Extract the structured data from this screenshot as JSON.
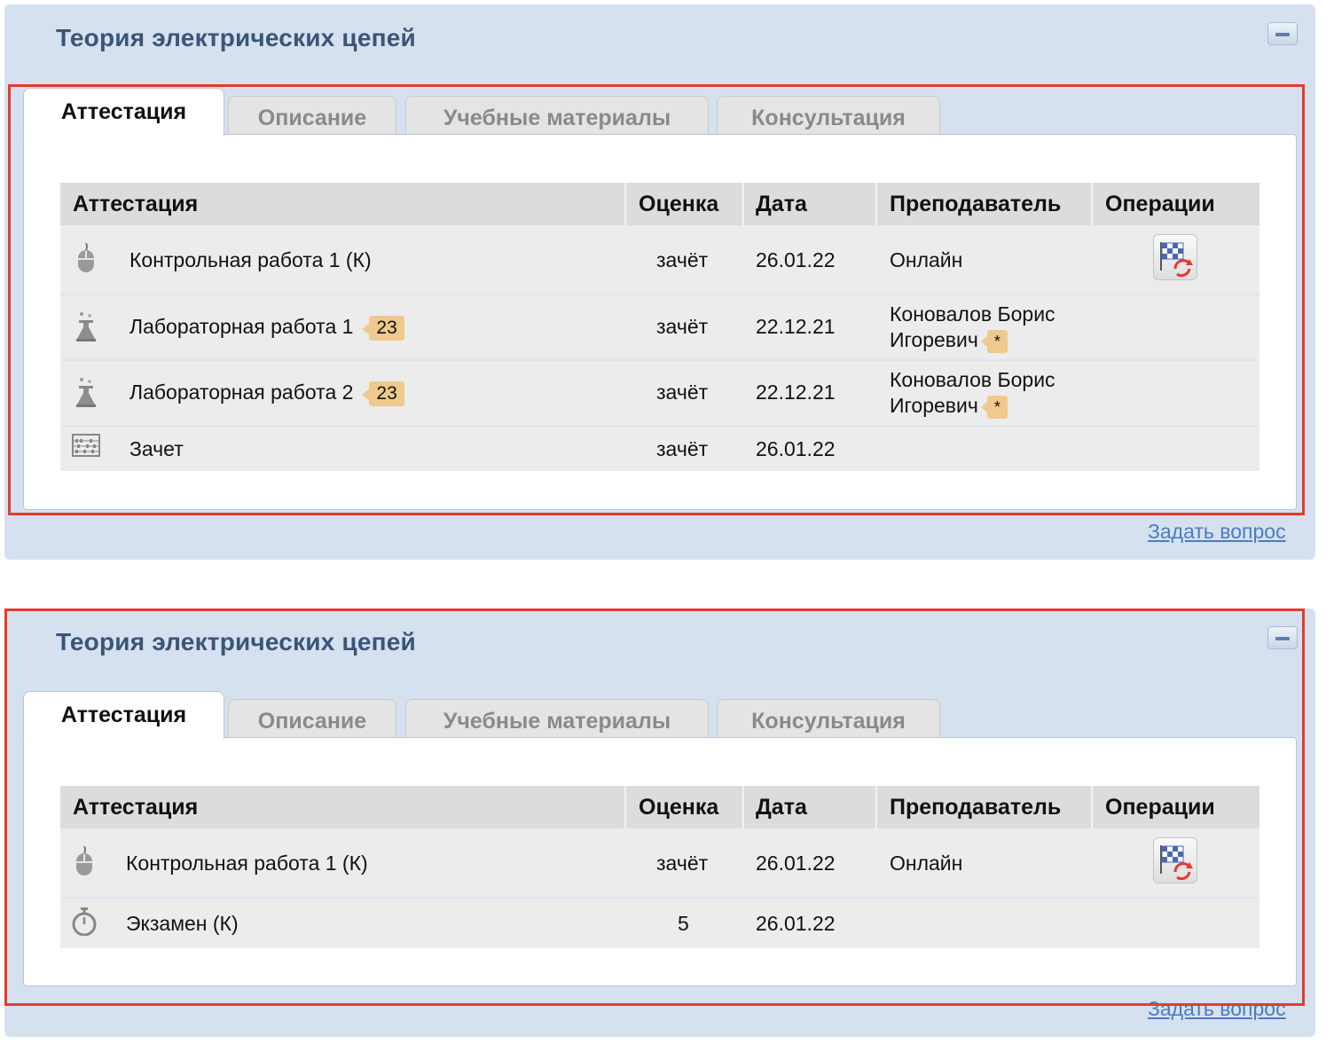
{
  "panels": [
    {
      "title": "Теория электрических цепей",
      "tabs": [
        "Аттестация",
        "Описание",
        "Учебные материалы",
        "Консультация"
      ],
      "headers": [
        "Аттестация",
        "Оценка",
        "Дата",
        "Преподаватель",
        "Операции"
      ],
      "rows": [
        {
          "icon": "mouse-icon",
          "name": "Контрольная работа 1 (К)",
          "badge": "",
          "grade": "зачёт",
          "date": "26.01.22",
          "teacher1": "Онлайн",
          "teacher2": "",
          "star": "",
          "op": "flag-refresh-icon"
        },
        {
          "icon": "lab-flask-icon",
          "name": "Лабораторная работа 1",
          "badge": "23",
          "grade": "зачёт",
          "date": "22.12.21",
          "teacher1": "Коновалов Борис",
          "teacher2": "Игоревич",
          "star": "*",
          "op": ""
        },
        {
          "icon": "lab-flask-icon",
          "name": "Лабораторная работа 2",
          "badge": "23",
          "grade": "зачёт",
          "date": "22.12.21",
          "teacher1": "Коновалов Борис",
          "teacher2": "Игоревич",
          "star": "*",
          "op": ""
        },
        {
          "icon": "abacus-icon",
          "name": "Зачет",
          "badge": "",
          "grade": "зачёт",
          "date": "26.01.22",
          "teacher1": "",
          "teacher2": "",
          "star": "",
          "op": ""
        }
      ],
      "ask_link": "Задать вопрос"
    },
    {
      "title": "Теория электрических цепей",
      "tabs": [
        "Аттестация",
        "Описание",
        "Учебные материалы",
        "Консультация"
      ],
      "headers": [
        "Аттестация",
        "Оценка",
        "Дата",
        "Преподаватель",
        "Операции"
      ],
      "rows": [
        {
          "icon": "mouse-icon",
          "name": "Контрольная работа 1 (К)",
          "grade": "зачёт",
          "date": "26.01.22",
          "teacher1": "Онлайн",
          "op": "flag-refresh-icon"
        },
        {
          "icon": "stopwatch-icon",
          "name": "Экзамен (К)",
          "grade": "5",
          "date": "26.01.22",
          "teacher1": "",
          "op": ""
        }
      ],
      "ask_link": "Задать вопрос"
    }
  ],
  "colors": {
    "panel_bg": "#d6e1f0",
    "title": "#3b5577",
    "highlight": "#e53a2c",
    "badge": "#efc98d",
    "link": "#4a7cc0"
  }
}
